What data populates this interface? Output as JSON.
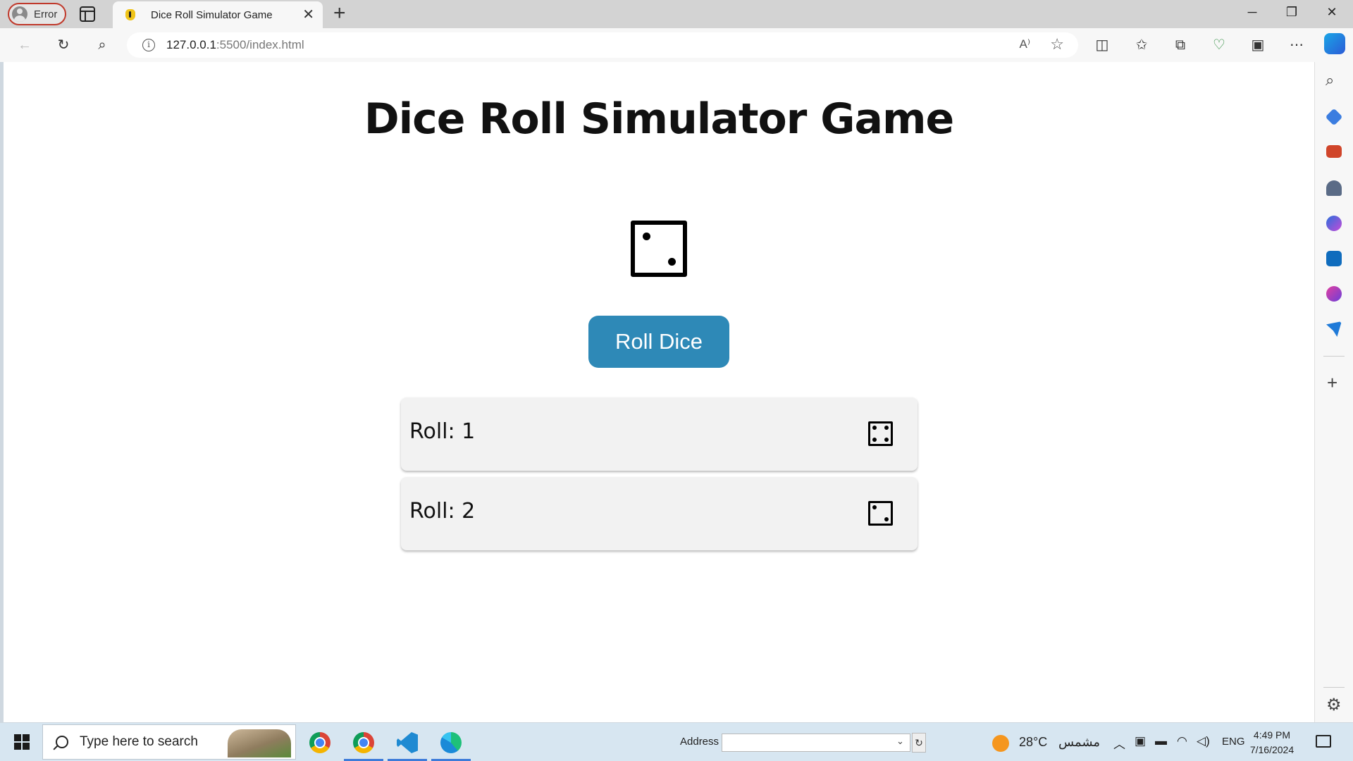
{
  "browser": {
    "profile_label": "Error",
    "tab_title": "Dice Roll Simulator Game",
    "tab_close": "✕",
    "new_tab": "+",
    "url_host": "127.0.0.1",
    "url_rest": ":5500/index.html",
    "window": {
      "minimize": "─",
      "maximize": "❐",
      "close": "✕"
    }
  },
  "page": {
    "title": "Dice Roll Simulator Game",
    "current_die_value": 2,
    "roll_button_label": "Roll Dice",
    "history": [
      {
        "label": "Roll: 1",
        "die_value": 4
      },
      {
        "label": "Roll: 2",
        "die_value": 2
      }
    ],
    "colors": {
      "button": "#2e89b7",
      "card": "#f2f2f2"
    }
  },
  "sidebar": {
    "items": [
      "search-icon",
      "shopping-tag-icon",
      "tools-icon",
      "games-icon",
      "microsoft-365-icon",
      "outlook-icon",
      "designer-icon",
      "drop-icon"
    ],
    "add_label": "+",
    "settings_label": "⚙"
  },
  "taskbar": {
    "search_placeholder": "Type here to search",
    "address_label": "Address",
    "address_value": "",
    "weather_temp": "28°C",
    "weather_condition": "مشمس",
    "language": "ENG",
    "time": "4:49 PM",
    "date": "7/16/2024"
  }
}
